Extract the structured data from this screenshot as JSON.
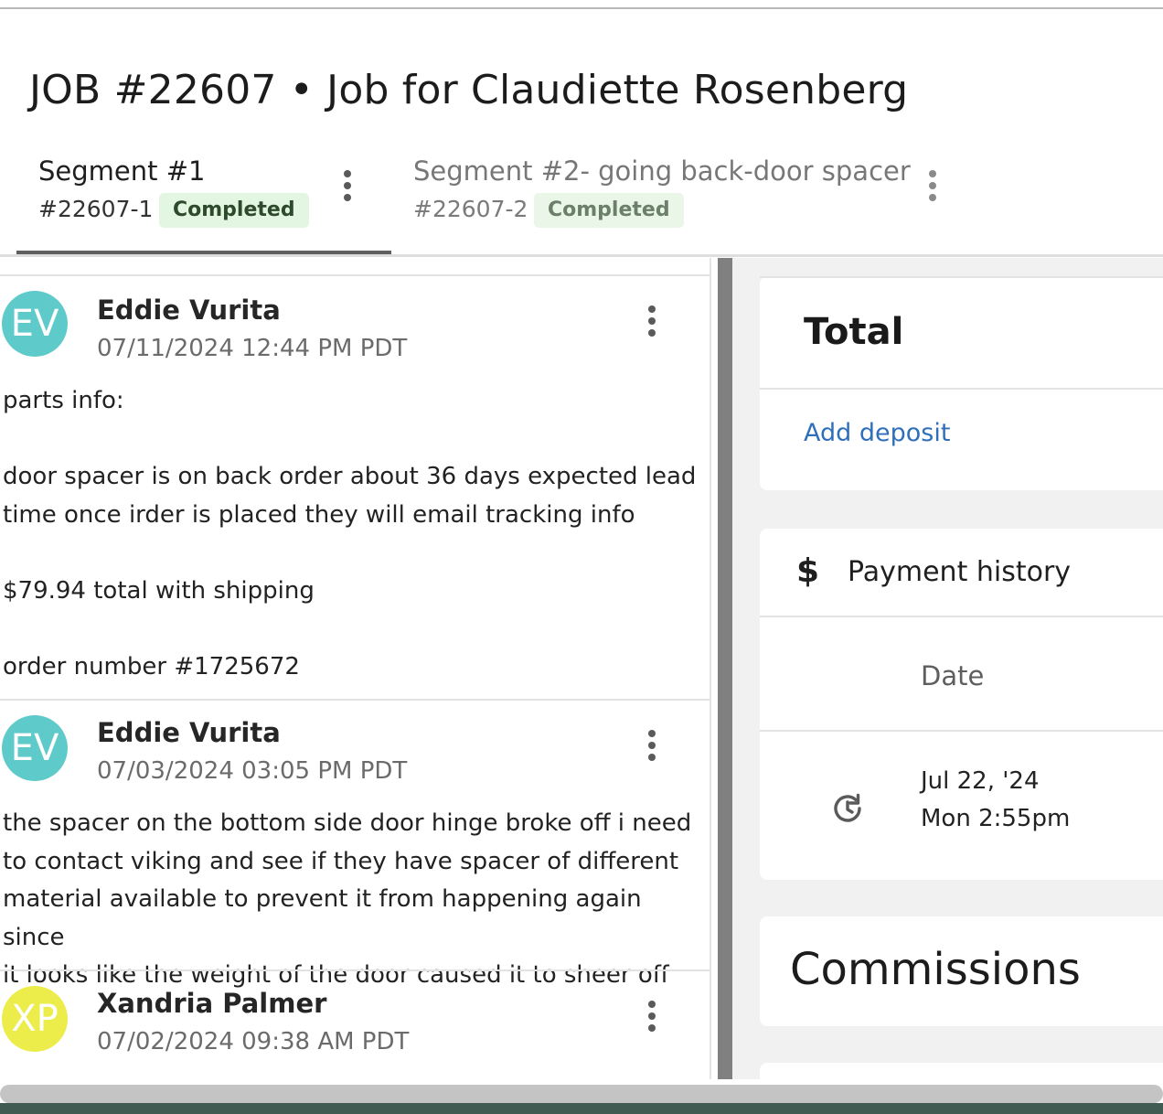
{
  "header": {
    "title": "JOB #22607 • Job for Claudiette Rosenberg"
  },
  "tabs": [
    {
      "name": "Segment #1",
      "number": "#22607-1",
      "status": "Completed"
    },
    {
      "name": "Segment #2- going back-door spacer",
      "number": "#22607-2",
      "status": "Completed"
    }
  ],
  "notes": [
    {
      "initials": "EV",
      "author": "Eddie Vurita",
      "timestamp": "07/11/2024 12:44 PM PDT",
      "avatar_color": "#5ecac9",
      "body": "parts info:\n\ndoor spacer is on back order about 36 days expected lead\ntime once irder is placed they will email tracking info\n\n$79.94 total with shipping\n\norder number #1725672"
    },
    {
      "initials": "EV",
      "author": "Eddie Vurita",
      "timestamp": "07/03/2024 03:05 PM PDT",
      "avatar_color": "#5ecac9",
      "body": "the spacer on the bottom side door hinge broke off i need\nto contact viking and see if they have spacer of different\nmaterial available to prevent it from happening again since\nit looks like the weight of the door caused it to sheer off"
    },
    {
      "initials": "XP",
      "author": "Xandria Palmer",
      "timestamp": "07/02/2024 09:38 AM PDT",
      "avatar_color": "#ecec4a",
      "body": ""
    }
  ],
  "totals": {
    "title": "Total",
    "add_deposit_label": "Add deposit"
  },
  "payment_history": {
    "title": "Payment history",
    "icon": "dollar-icon",
    "column_date": "Date",
    "rows": [
      {
        "date": "Jul 22, '24",
        "time": "Mon 2:55pm",
        "icon": "history-icon"
      }
    ]
  },
  "commissions": {
    "title": "Commissions"
  },
  "colors": {
    "link": "#2f6fba",
    "status_bg": "#e3f6e1",
    "active_tab_underline": "#5f5f5f"
  }
}
